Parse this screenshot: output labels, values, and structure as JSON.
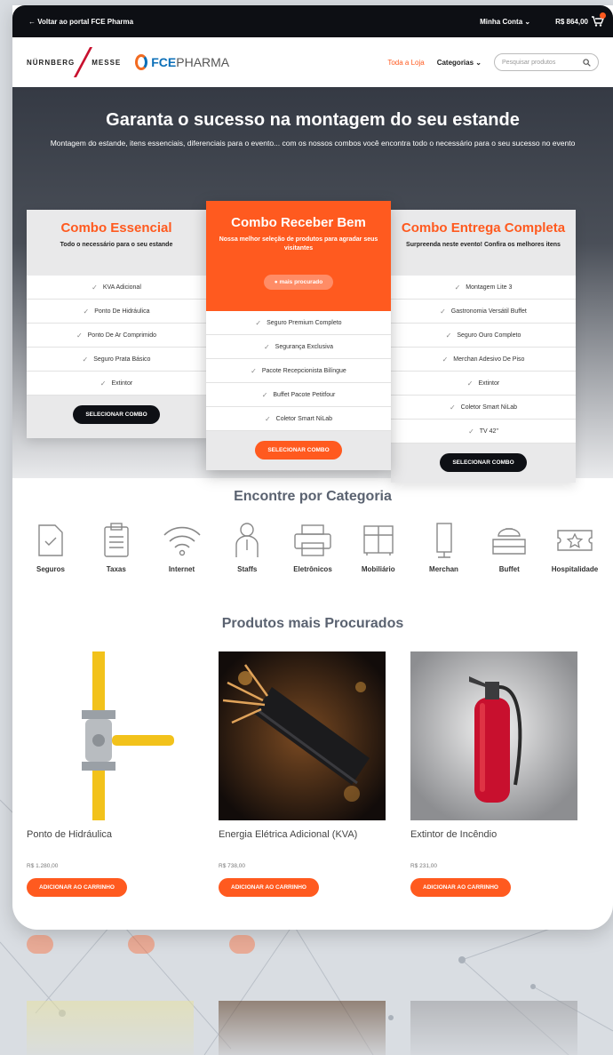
{
  "topbar": {
    "back": "← Voltar ao portal FCE Pharma",
    "account": "Minha Conta",
    "price": "R$ 864,00"
  },
  "nav": {
    "logo_nm": "NÜRNBERG",
    "logo_nm2": "MESSE",
    "logo_fce_bold": "FCE",
    "logo_fce": "PHARMA",
    "store": "Toda a Loja",
    "categories": "Categorias",
    "search_placeholder": "Pesquisar produtos"
  },
  "hero": {
    "title": "Garanta o sucesso na montagem do seu estande",
    "subtitle": "Montagem do estande, itens essenciais, diferenciais para o evento... com os nossos combos você encontra todo o necessário para o seu sucesso no evento"
  },
  "combos": [
    {
      "title": "Combo Essencial",
      "sub": "Todo o necessário para o seu estande",
      "items": [
        "KVA Adicional",
        "Ponto De Hidráulica",
        "Ponto De Ar Comprimido",
        "Seguro Prata Básico",
        "Extintor"
      ],
      "button": "SELECIONAR COMBO"
    },
    {
      "title": "Combo Receber Bem",
      "sub": "Nossa melhor seleção de produtos para agradar seus visitantes",
      "badge": "mais procurado",
      "items": [
        "Seguro Premium Completo",
        "Segurança Exclusiva",
        "Pacote Recepcionista Bilíngue",
        "Buffet Pacote Petitfour",
        "Coletor Smart NiLab"
      ],
      "button": "SELECIONAR COMBO"
    },
    {
      "title": "Combo Entrega Completa",
      "sub": "Surpreenda neste evento! Confira os melhores itens",
      "items": [
        "Montagem Lite 3",
        "Gastronomia Versátil Buffet",
        "Seguro Ouro Completo",
        "Merchan Adesivo De Piso",
        "Extintor",
        "Coletor Smart NiLab",
        "TV 42\""
      ],
      "button": "SELECIONAR COMBO"
    }
  ],
  "categories_title": "Encontre por Categoria",
  "categories": [
    "Seguros",
    "Taxas",
    "Internet",
    "Staffs",
    "Eletrônicos",
    "Mobiliário",
    "Merchan",
    "Buffet",
    "Hospitalidade"
  ],
  "products_title": "Produtos mais Procurados",
  "products": [
    {
      "name": "Ponto de Hidráulica",
      "price": "R$ 1.280,00",
      "button": "ADICIONAR AO CARRINHO"
    },
    {
      "name": "Energia Elétrica Adicional (KVA)",
      "price": "R$ 738,00",
      "button": "ADICIONAR AO CARRINHO"
    },
    {
      "name": "Extintor de Incêndio",
      "price": "R$ 231,00",
      "button": "ADICIONAR AO CARRINHO"
    }
  ],
  "colors": {
    "accent": "#ff5a1f",
    "dark": "#0e1015",
    "heading": "#5a6270"
  }
}
